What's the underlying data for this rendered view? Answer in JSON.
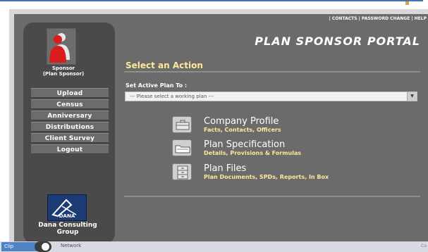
{
  "top_links": "| CONTACTS  | PASSWORD CHANGE  | HELP",
  "portal_title": "PLAN SPONSOR PORTAL",
  "user": {
    "role_line1": "Sponsor",
    "role_line2": "(Plan Sponsor)"
  },
  "nav": {
    "items": [
      "Upload",
      "Census",
      "Anniversary",
      "Distributions",
      "Client Survey",
      "Logout"
    ]
  },
  "main": {
    "select_action": "Select an Action",
    "set_active_plan": "Set Active Plan To :",
    "plan_placeholder": "--- Please select a working plan ---"
  },
  "actions": [
    {
      "title": "Company Profile",
      "subtitle": "Facts, Contacts, Officers",
      "icon": "briefcase-icon"
    },
    {
      "title": "Plan Specification",
      "subtitle": "Details, Provisions & Formulas",
      "icon": "folder-icon"
    },
    {
      "title": "Plan Files",
      "subtitle": "Plan Documents, SPDs, Reports, In Box",
      "icon": "cabinet-icon"
    }
  ],
  "logo": {
    "text": "DANA",
    "company_line1": "Dana Consulting",
    "company_line2": "Group"
  },
  "taskbar": {
    "start": "Clip",
    "network": "Network",
    "right": "Co"
  },
  "colors": {
    "portal_bg": "#6b6b6b",
    "sidebar_bg": "#4a4a4a",
    "accent_yellow": "#ffe89a",
    "logo_blue": "#1c3a73"
  }
}
